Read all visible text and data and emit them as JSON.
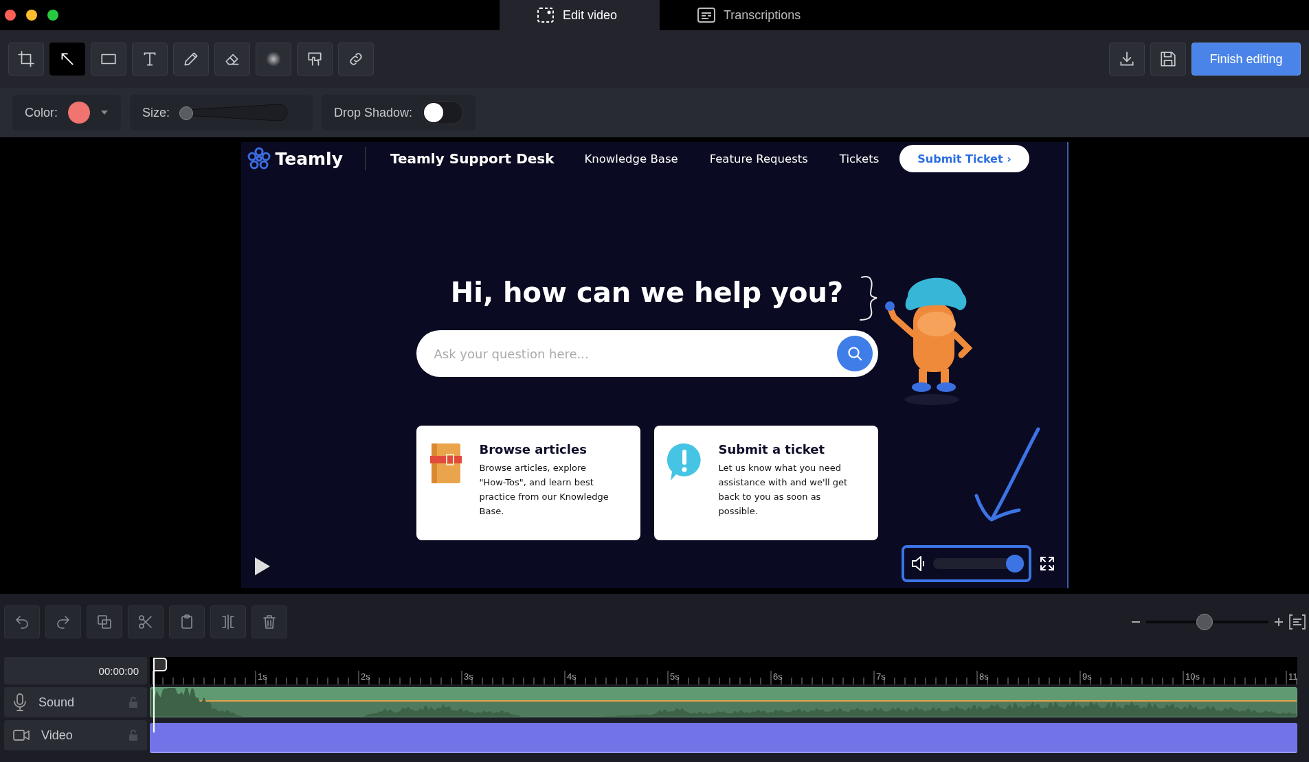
{
  "window": {
    "lights": [
      {
        "color": "#fe5f57"
      },
      {
        "color": "#febc2e"
      },
      {
        "color": "#28c840"
      }
    ]
  },
  "tabs": [
    {
      "label": "Edit video",
      "selected": true
    },
    {
      "label": "Transcriptions",
      "selected": false
    }
  ],
  "tools": [
    {
      "selected": false
    },
    {
      "selected": true
    },
    {
      "selected": false
    },
    {
      "selected": false
    },
    {
      "selected": false
    },
    {
      "selected": false
    },
    {
      "selected": false
    },
    {
      "selected": false
    },
    {
      "selected": false
    }
  ],
  "finish_button": "Finish editing",
  "options": {
    "color": {
      "label": "Color:",
      "color": "#f07470"
    },
    "size": {
      "label": "Size:",
      "level": 0
    },
    "drop_shadow": {
      "label": "Drop Shadow:",
      "on": false
    }
  },
  "video": {
    "logo": "Teamly",
    "title": "Teamly Support Desk",
    "nav": [
      "Knowledge Base",
      "Feature Requests",
      "Tickets"
    ],
    "submit_button": "Submit Ticket ›",
    "headline": "Hi, how can we help you?",
    "search": {
      "placeholder": "Ask your question here..."
    },
    "cards": [
      {
        "title": "Browse articles",
        "text": "Browse articles, explore \"How-Tos\", and learn best practice from our Knowledge Base."
      },
      {
        "title": "Submit a ticket",
        "text": "Let us know what you need assistance with and we'll get back to you as soon as possible."
      }
    ],
    "volume": {
      "level": 0.9
    }
  },
  "timeline": {
    "zoom": {
      "level": 0.48
    },
    "timecode": "00:00:00",
    "ruler": [
      "1s",
      "2s",
      "3s",
      "4s",
      "5s",
      "6s",
      "7s",
      "8s",
      "9s",
      "10s",
      "11"
    ],
    "tracks": [
      {
        "label": "Sound",
        "kind": "audio"
      },
      {
        "label": "Video",
        "kind": "video"
      }
    ]
  }
}
